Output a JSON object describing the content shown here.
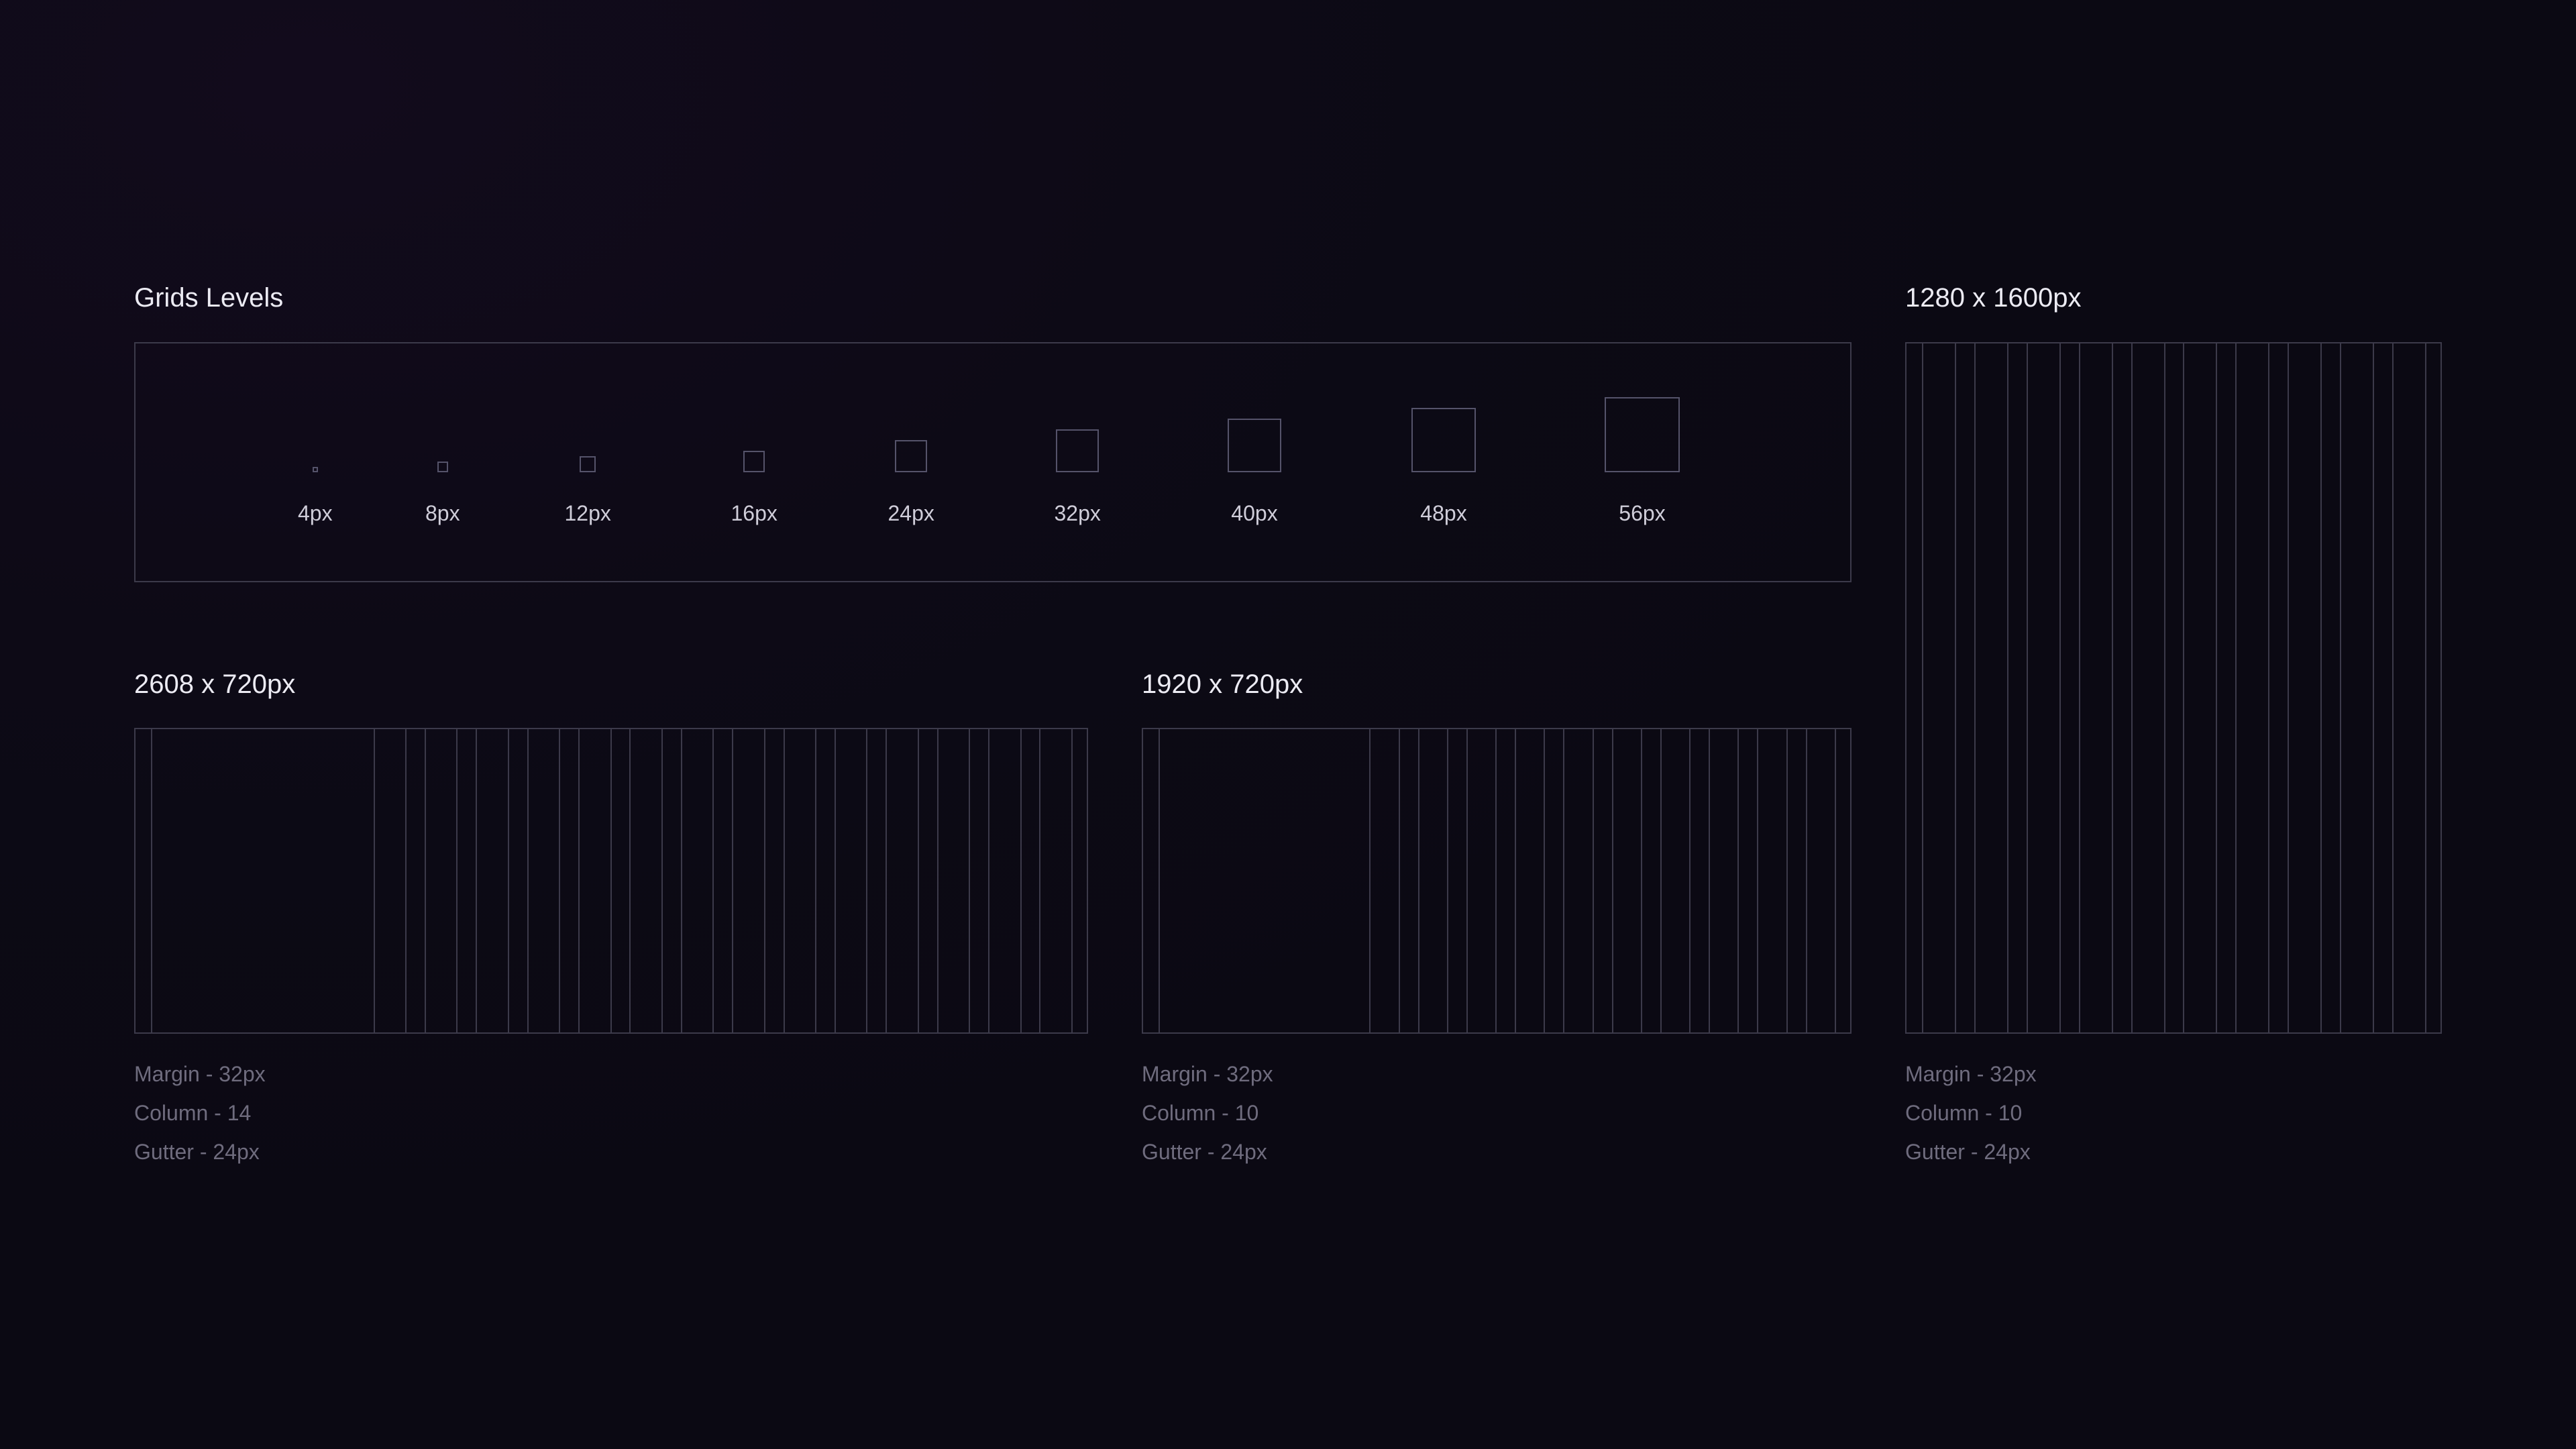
{
  "levels_section": {
    "title": "Grids Levels",
    "levels": [
      {
        "label": "4px",
        "size": 4
      },
      {
        "label": "8px",
        "size": 8
      },
      {
        "label": "12px",
        "size": 12
      },
      {
        "label": "16px",
        "size": 16
      },
      {
        "label": "24px",
        "size": 24
      },
      {
        "label": "32px",
        "size": 32
      },
      {
        "label": "40px",
        "size": 40
      },
      {
        "label": "48px",
        "size": 48
      },
      {
        "label": "56px",
        "size": 56
      }
    ]
  },
  "grids": [
    {
      "title": "2608 x 720px",
      "specs": {
        "margin": "Margin - 32px",
        "column": "Column - 14",
        "gutter": "Gutter - 24px"
      },
      "margin": 32,
      "columns": 14,
      "gutter": 24
    },
    {
      "title": "1920 x 720px",
      "specs": {
        "margin": "Margin - 32px",
        "column": "Column - 10",
        "gutter": "Gutter - 24px"
      },
      "margin": 32,
      "columns": 10,
      "gutter": 24
    },
    {
      "title": "1280 x 1600px",
      "specs": {
        "margin": "Margin - 32px",
        "column": "Column - 10",
        "gutter": "Gutter - 24px"
      },
      "margin": 32,
      "columns": 10,
      "gutter": 24
    }
  ],
  "colors": {
    "background": "#0d0a16",
    "title_text": "#ecebf3",
    "label_text": "#cfcdd9",
    "spec_text": "#6f6c7e",
    "guide_line": "#3c3a4a"
  }
}
